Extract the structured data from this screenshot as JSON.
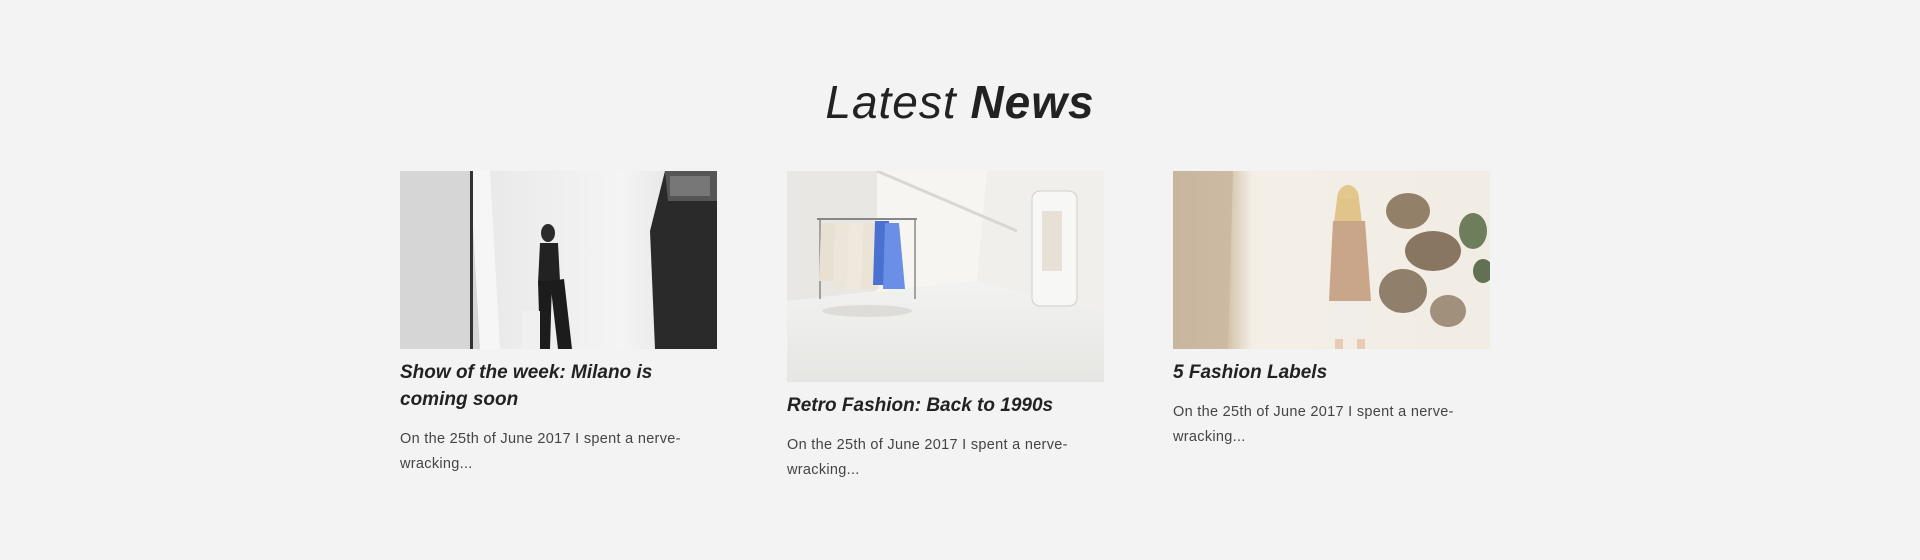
{
  "section": {
    "heading_light": "Latest",
    "heading_bold": "News"
  },
  "posts": [
    {
      "title": "Show of the week: Milano is coming soon",
      "excerpt": "On the 25th of June 2017 I spent a nerve-wracking...",
      "image": "model-sitting-studio-photo"
    },
    {
      "title": "Retro Fashion: Back to 1990s",
      "excerpt": "On the 25th of June 2017 I spent a nerve-wracking...",
      "image": "boutique-clothing-rack-photo"
    },
    {
      "title": "5 Fashion Labels",
      "excerpt": "On the 25th of June 2017 I spent a nerve-wracking...",
      "image": "blonde-model-sunlight-photo"
    }
  ]
}
